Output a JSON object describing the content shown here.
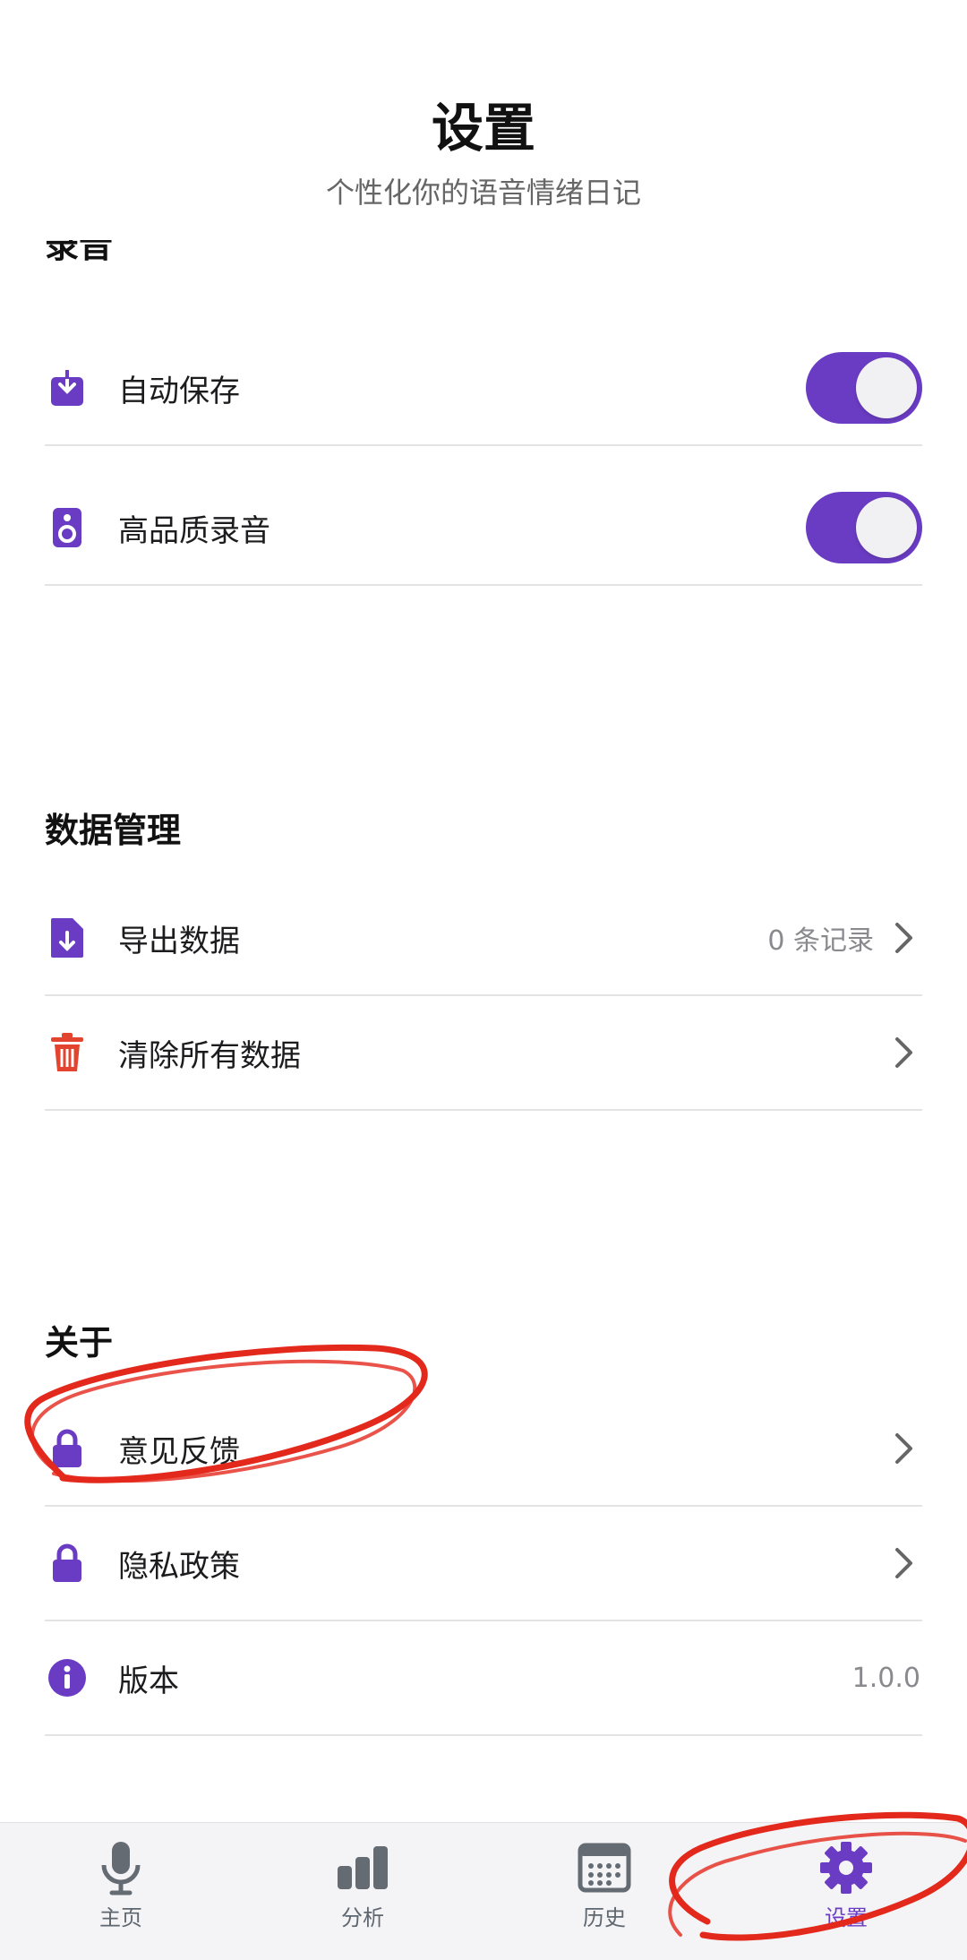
{
  "header": {
    "title": "设置",
    "subtitle": "个性化你的语音情绪日记"
  },
  "sections": {
    "recording": {
      "title": "录音",
      "items": [
        {
          "label": "自动保存",
          "icon": "download-box-icon",
          "toggle": true
        },
        {
          "label": "高品质录音",
          "icon": "speaker-icon",
          "toggle": true
        }
      ]
    },
    "data": {
      "title": "数据管理",
      "items": [
        {
          "label": "导出数据",
          "value": "0 条记录",
          "icon": "export-file-icon"
        },
        {
          "label": "清除所有数据",
          "icon": "trash-icon"
        }
      ]
    },
    "about": {
      "title": "关于",
      "items": [
        {
          "label": "意见反馈",
          "icon": "lock-icon"
        },
        {
          "label": "隐私政策",
          "icon": "lock-icon"
        },
        {
          "label": "版本",
          "value": "1.0.0",
          "icon": "info-icon"
        }
      ]
    }
  },
  "tabbar": {
    "tabs": [
      {
        "label": "主页",
        "icon": "microphone-icon"
      },
      {
        "label": "分析",
        "icon": "bar-chart-icon"
      },
      {
        "label": "历史",
        "icon": "calendar-icon"
      },
      {
        "label": "设置",
        "icon": "gear-icon",
        "active": true
      }
    ]
  },
  "colors": {
    "accent": "#6a3cc3",
    "danger": "#e2442f",
    "annotation": "#e3281c"
  }
}
